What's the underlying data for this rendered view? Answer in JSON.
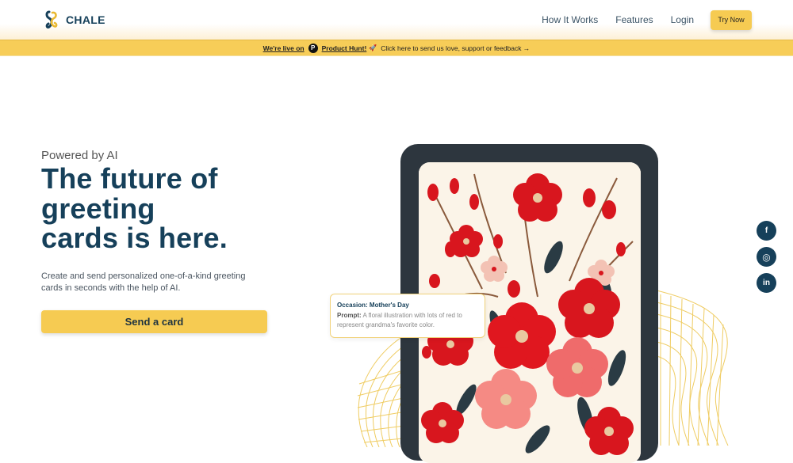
{
  "header": {
    "brand": "CHALE",
    "nav": [
      {
        "label": "How It Works"
      },
      {
        "label": "Features"
      },
      {
        "label": "Login"
      }
    ],
    "cta_label": "Try Now"
  },
  "banner": {
    "prefix": "We're live on",
    "ph_letter": "P",
    "product": "Product Hunt!",
    "emoji": "🚀",
    "message": "Click here to send us love, support or feedback →"
  },
  "hero": {
    "eyebrow": "Powered by AI",
    "headline_lines": [
      "The future of",
      "greeting",
      "cards is here."
    ],
    "subtext": "Create and send personalized one-of-a-kind greeting cards in seconds with the help of AI.",
    "cta_label": "Send a card"
  },
  "prompt_card": {
    "occasion_label": "Occasion:",
    "occasion_value": "Mother's Day",
    "prompt_label": "Prompt:",
    "prompt_value": "A floral illustration with lots of red to represent grandma's favorite color."
  },
  "social": [
    {
      "name": "facebook",
      "glyph": "f"
    },
    {
      "name": "instagram",
      "glyph": "◎"
    },
    {
      "name": "linkedin",
      "glyph": "in"
    }
  ],
  "colors": {
    "brand_navy": "#16405a",
    "accent_yellow": "#f6cb52",
    "phone_frame": "#2d363e",
    "flower_red": "#d8161e"
  }
}
